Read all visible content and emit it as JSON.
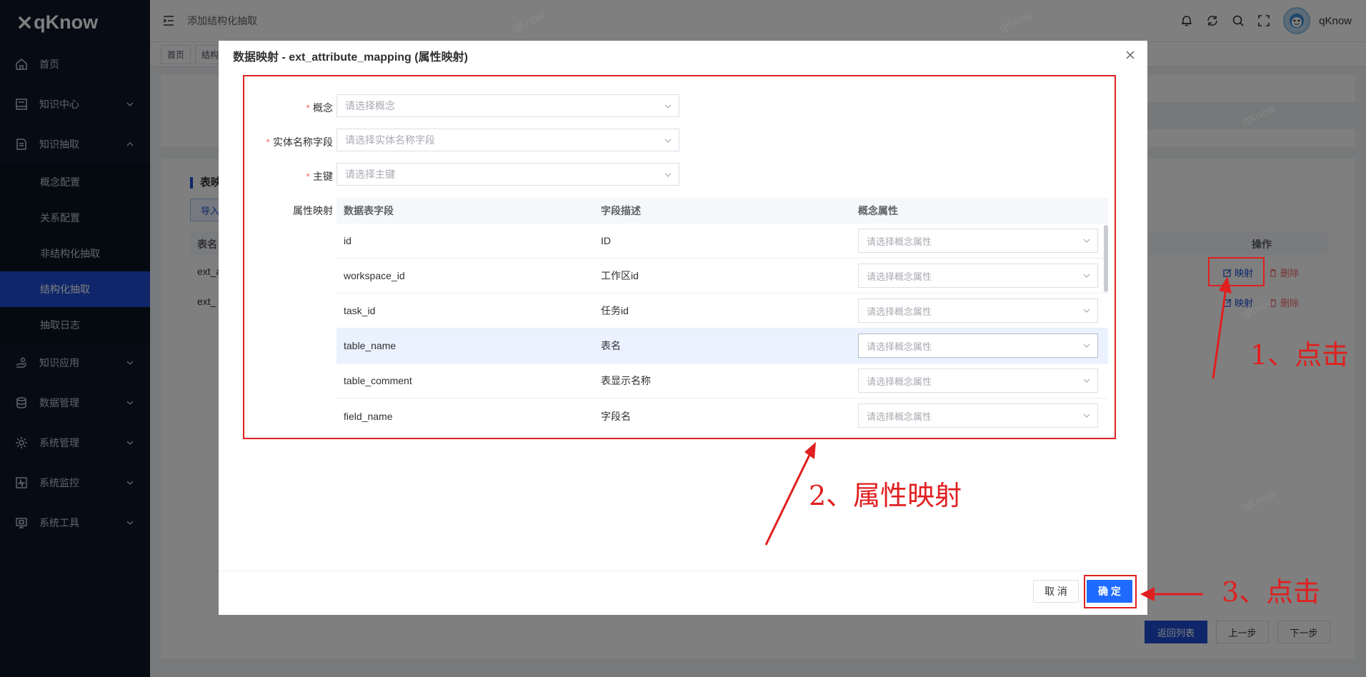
{
  "app": {
    "name": "qKnow"
  },
  "sidebar": {
    "items": [
      {
        "label": "首页",
        "icon": "home-icon"
      },
      {
        "label": "知识中心",
        "icon": "book-icon"
      },
      {
        "label": "知识抽取",
        "icon": "document-icon"
      },
      {
        "label": "知识应用",
        "icon": "hand-icon"
      },
      {
        "label": "数据管理",
        "icon": "database-icon"
      },
      {
        "label": "系统管理",
        "icon": "gear-icon"
      },
      {
        "label": "系统监控",
        "icon": "monitor-icon"
      },
      {
        "label": "系统工具",
        "icon": "toolbox-icon"
      }
    ],
    "sub_items": [
      {
        "label": "概念配置"
      },
      {
        "label": "关系配置"
      },
      {
        "label": "非结构化抽取"
      },
      {
        "label": "结构化抽取"
      },
      {
        "label": "抽取日志"
      }
    ]
  },
  "header": {
    "breadcrumb": "添加结构化抽取",
    "username": "qKnow"
  },
  "tags": [
    "首页",
    "结构"
  ],
  "page": {
    "section_title": "表映",
    "import_label": "导入",
    "table_header_first": "表名",
    "table_header_op": "操作",
    "rows": [
      {
        "name": "ext_a",
        "map": "映射",
        "delete": "删除"
      },
      {
        "name": "ext_",
        "map": "映射",
        "delete": "删除"
      }
    ],
    "footer": {
      "back": "返回列表",
      "prev": "上一步",
      "next": "下一步"
    }
  },
  "watermark": "qKnow",
  "dialog": {
    "title": "数据映射 - ext_attribute_mapping (属性映射)",
    "fields": {
      "concept": {
        "label": "概念",
        "placeholder": "请选择概念"
      },
      "entity_name": {
        "label": "实体名称字段",
        "placeholder": "请选择实体名称字段"
      },
      "primary_key": {
        "label": "主键",
        "placeholder": "请选择主键"
      },
      "attr_mapping": {
        "label": "属性映射"
      }
    },
    "table": {
      "headers": [
        "数据表字段",
        "字段描述",
        "概念属性"
      ],
      "rows": [
        {
          "field": "id",
          "desc": "ID",
          "placeholder": "请选择概念属性"
        },
        {
          "field": "workspace_id",
          "desc": "工作区id",
          "placeholder": "请选择概念属性"
        },
        {
          "field": "task_id",
          "desc": "任务id",
          "placeholder": "请选择概念属性"
        },
        {
          "field": "table_name",
          "desc": "表名",
          "placeholder": "请选择概念属性"
        },
        {
          "field": "table_comment",
          "desc": "表显示名称",
          "placeholder": "请选择概念属性"
        },
        {
          "field": "field_name",
          "desc": "字段名",
          "placeholder": "请选择概念属性"
        }
      ]
    },
    "cancel_label": "取 消",
    "confirm_label": "确 定"
  },
  "annotations": {
    "step1": "1、点击",
    "step2": "2、属性映射",
    "step3": "3、点击"
  },
  "colors": {
    "sidebar_bg": "#0f1728",
    "active": "#1f4fd4",
    "primary_button": "#1f6bff",
    "annotation": "#e01f1f",
    "danger": "#f56c6c"
  }
}
